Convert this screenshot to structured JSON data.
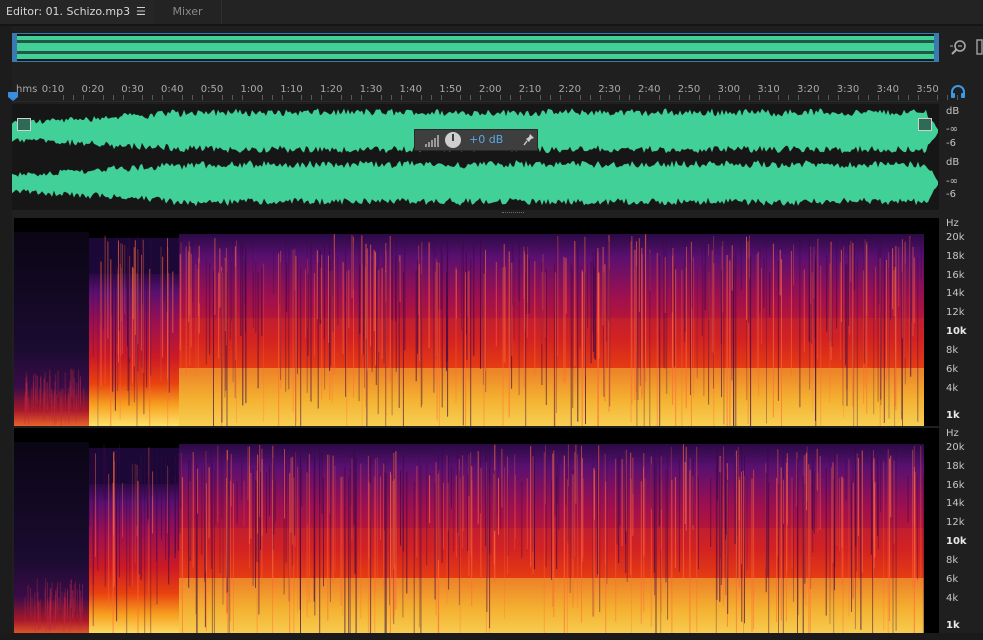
{
  "tabs": {
    "editor_label": "Editor: 01. Schizo.mp3",
    "menu_glyph": "☰",
    "mixer_label": "Mixer"
  },
  "ruler": {
    "unit_label": "hms",
    "ticks": [
      "0:10",
      "0:20",
      "0:30",
      "0:40",
      "0:50",
      "1:00",
      "1:10",
      "1:20",
      "1:30",
      "1:40",
      "1:50",
      "2:00",
      "2:10",
      "2:20",
      "2:30",
      "2:40",
      "2:50",
      "3:00",
      "3:10",
      "3:20",
      "3:30",
      "3:40",
      "3:50"
    ]
  },
  "hud": {
    "gain_label": "+0 dB"
  },
  "db_scale": {
    "unit": "dB",
    "neg_inf": "-∞",
    "minus6": "-6"
  },
  "hz_scale": {
    "unit": "Hz",
    "labels": [
      "20k",
      "18k",
      "16k",
      "14k",
      "12k",
      "10k",
      "8k",
      "6k",
      "4k",
      "1k"
    ],
    "bold": [
      "10k",
      "1k"
    ]
  },
  "colors": {
    "waveform": "#40d098",
    "accent": "#3a7ab0",
    "hud_value": "#58a8e8",
    "background": "#1f1f1f"
  },
  "icons": [
    "zoom-to-selection-icon",
    "headphones-icon",
    "pin-icon",
    "level-bars-icon",
    "menu-icon",
    "playhead-icon"
  ]
}
